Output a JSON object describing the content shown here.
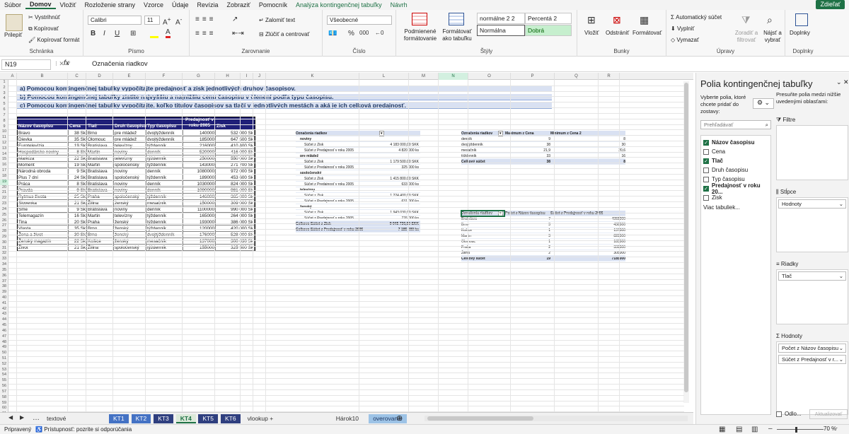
{
  "menu": {
    "items": [
      "Súbor",
      "Domov",
      "Vložiť",
      "Rozloženie strany",
      "Vzorce",
      "Údaje",
      "Revízia",
      "Zobraziť",
      "Pomocník",
      "Analýza kontingenčnej tabuľky",
      "Návrh"
    ],
    "share": "Zdieľať"
  },
  "ribbon": {
    "clipboard": {
      "paste": "Prilepiť",
      "cut": "Vystrihnúť",
      "copy": "Kopírovať",
      "format_painter": "Kopírovať formát",
      "label": "Schránka"
    },
    "font": {
      "name": "Calibri",
      "size": "11",
      "label": "Písmo",
      "bold": "B",
      "italic": "I",
      "underline": "U"
    },
    "alignment": {
      "wrap": "Zalomiť text",
      "merge": "Zlúčiť a centrovať",
      "label": "Zarovnanie"
    },
    "number": {
      "format": "Všeobecné",
      "percent": "%",
      "thousands": "000",
      "label": "Číslo"
    },
    "styles": {
      "conditional": "Podmienené formátovanie",
      "as_table": "Formátovať ako tabuľku",
      "s1": "normálne 2 2",
      "s2": "Percentá 2",
      "s3": "Normálna",
      "s4": "Dobrá",
      "label": "Štýly"
    },
    "cells": {
      "insert": "Vložiť",
      "delete": "Odstrániť",
      "format": "Formátovať",
      "label": "Bunky"
    },
    "editing": {
      "autosum": "Automatický súčet",
      "fill": "Vyplniť",
      "clear": "Vymazať",
      "sort": "Zoradiť a filtrovať",
      "find": "Nájsť a vybrať",
      "label": "Úpravy"
    },
    "addins": {
      "btn": "Doplnky",
      "label": "Doplnky"
    }
  },
  "formula_bar": {
    "name_box": "N19",
    "fx": "fx",
    "content": "Označenia riadkov"
  },
  "columns": [
    "A",
    "B",
    "C",
    "D",
    "E",
    "F",
    "G",
    "H",
    "I",
    "J",
    "K",
    "L",
    "M",
    "N",
    "O",
    "P",
    "Q",
    "R"
  ],
  "rows": [
    "1",
    "2",
    "3",
    "4",
    "5",
    "6",
    "7",
    "8",
    "9",
    "10",
    "11",
    "12",
    "13",
    "14",
    "15",
    "16",
    "17",
    "18",
    "19",
    "20",
    "21",
    "22",
    "23",
    "24",
    "25",
    "26",
    "27",
    "28",
    "29",
    "30",
    "31",
    "32",
    "33",
    "34",
    "35",
    "36",
    "37",
    "38",
    "39",
    "40",
    "41",
    "42",
    "43",
    "44",
    "45",
    "46",
    "47",
    "48",
    "49",
    "50",
    "51",
    "52",
    "53",
    "54",
    "55",
    "56",
    "57",
    "58",
    "59",
    "60",
    "61"
  ],
  "tasks": [
    "a) Pomocou kontingenčnej tabuľky vypočítajte predajnosť a zisk jednotlivých druhov časopisov.",
    "b) Pomocou kontingenčnej tabuľky zistite najvyššiu a najnižšiu cenu časopisu v členení podľa typu časopisu.",
    "c) Pomocou kontingenčnej tabuľky vypočítajte, koľko titulov časopisov sa tlačí v jednotlivých mestách a aká je ich celková predajnosť."
  ],
  "table": {
    "headers": [
      "Názov časopisu",
      "Cena",
      "Tlač",
      "Druh časopisu",
      "Typ časopisu",
      "Predajnosť v roku 2005",
      "Zisk"
    ],
    "rows": [
      [
        "Bravo",
        "38 Sk",
        "Brno",
        "pre mládež",
        "dvojtýždenník",
        "140000",
        "532 000 Sk"
      ],
      [
        "Dievka",
        "35 Sk",
        "Olomouc",
        "pre mládež",
        "dvojtýždenník",
        "185000",
        "647 500 Sk"
      ],
      [
        "Eurotelevízia",
        "19 Sk",
        "Bratislava",
        "televízny",
        "týždenník",
        "216000",
        "410 400 Sk"
      ],
      [
        "Hospodárske noviny",
        "8 Sk",
        "Martin",
        "noviny",
        "denník",
        "520000",
        "416 000 Sk"
      ],
      [
        "Markíza",
        "22 Sk",
        "Bratislava",
        "televízny",
        "týždenník",
        "250000",
        "550 000 Sk"
      ],
      [
        "Moment",
        "19 Sk",
        "Martin",
        "spoločenský",
        "týždenník",
        "143000",
        "271 700 Sk"
      ],
      [
        "Národná obroda",
        "9 Sk",
        "Bratislava",
        "noviny",
        "denník",
        "1080000",
        "972 000 Sk"
      ],
      [
        "Plus 7 dní",
        "24 Sk",
        "Bratislava",
        "spoločenský",
        "týždenník",
        "189000",
        "453 600 Sk"
      ],
      [
        "Práca",
        "8 Sk",
        "Bratislava",
        "noviny",
        "denník",
        "1030000",
        "824 000 Sk"
      ],
      [
        "Pravda",
        "9 Sk",
        "Bratislava",
        "noviny",
        "denník",
        "1090000",
        "981 000 Sk"
      ],
      [
        "Rytmus života",
        "25 Sk",
        "Praha",
        "spoločenský",
        "týždenník",
        "146000",
        "365 000 Sk"
      ],
      [
        "Slovenka",
        "21 Sk",
        "Žilina",
        "ženský",
        "mesačník",
        "150000",
        "309 000 Sk"
      ],
      [
        "Sme",
        "9 Sk",
        "Bratislava",
        "noviny",
        "denník",
        "1100000",
        "990 000 Sk"
      ],
      [
        "Telemagazín",
        "16 Sk",
        "Martin",
        "televízny",
        "týždenník",
        "165000",
        "264 000 Sk"
      ],
      [
        "Tina",
        "20 Sk",
        "Praha",
        "ženský",
        "týždenník",
        "193000",
        "386 000 Sk"
      ],
      [
        "Vlasta",
        "35 Sk",
        "Brno",
        "ženský",
        "týždenník",
        "120000",
        "420 000 Sk"
      ],
      [
        "Žena a život",
        "30 Sk",
        "Brno",
        "ženský",
        "dvojtýždenník",
        "176000",
        "528 000 Sk"
      ],
      [
        "Ženský magazín",
        "22 Sk",
        "Košice",
        "ženský",
        "mesačník",
        "137000",
        "300 030 Sk"
      ],
      [
        "Život",
        "21 Sk",
        "Žilina",
        "spoločenský",
        "týždenník",
        "155000",
        "325 500 Sk"
      ]
    ]
  },
  "pivot1": {
    "header": "Označenia riadkov",
    "rows": [
      {
        "label": "noviny",
        "v": "",
        "lvl": 0
      },
      {
        "label": "Súčet z Zisk",
        "v": "4 183 000,00 SKK",
        "lvl": 1
      },
      {
        "label": "Súčet z Predajnosť v roku 2005",
        "v": "4 820 000 ks",
        "lvl": 1
      },
      {
        "label": "pre mládež",
        "v": "",
        "lvl": 0
      },
      {
        "label": "Súčet z Zisk",
        "v": "1 179 500,00 SKK",
        "lvl": 1
      },
      {
        "label": "Súčet z Predajnosť v roku 2005",
        "v": "325 000 ks",
        "lvl": 1
      },
      {
        "label": "spoločenský",
        "v": "",
        "lvl": 0
      },
      {
        "label": "Súčet z Zisk",
        "v": "1 415 800,00 SKK",
        "lvl": 1
      },
      {
        "label": "Súčet z Predajnosť v roku 2005",
        "v": "633 000 ks",
        "lvl": 1
      },
      {
        "label": "televízny",
        "v": "",
        "lvl": 0
      },
      {
        "label": "Súčet z Zisk",
        "v": "1 224 400,00 SKK",
        "lvl": 1
      },
      {
        "label": "Súčet z Predajnosť v roku 2005",
        "v": "631 000 ks",
        "lvl": 1
      },
      {
        "label": "ženský",
        "v": "",
        "lvl": 0
      },
      {
        "label": "Súčet z Zisk",
        "v": "1 943 030,00 SKK",
        "lvl": 1
      },
      {
        "label": "Súčet z Predajnosť v roku 2005",
        "v": "776 000 ks",
        "lvl": 1
      },
      {
        "label": "Celkovo Súčet z Zisk",
        "v": "9 945 730,00 SKK",
        "lvl": 2
      },
      {
        "label": "Celkovo Súčet z Predajnosť v roku 2005",
        "v": "7 185 000 ks",
        "lvl": 2
      }
    ]
  },
  "pivot2": {
    "headers": [
      "Označenia riadkov",
      "Maximum z Cena",
      "Minimum z Cena 2"
    ],
    "rows": [
      [
        "denník",
        "9",
        "8"
      ],
      [
        "dvojtýždenník",
        "38",
        "30"
      ],
      [
        "mesačník",
        "21,9",
        "20,6"
      ],
      [
        "týždenník",
        "33",
        "16"
      ]
    ],
    "total": [
      "Celkový súčet",
      "38",
      "8"
    ]
  },
  "pivot3": {
    "headers": [
      "Označenia riadkov",
      "Počet z Názov časopisu",
      "Súčet z Predajnosť v roku 2005"
    ],
    "rows": [
      [
        "Bratislava",
        "7",
        "4955000"
      ],
      [
        "Brno",
        "3",
        "436000"
      ],
      [
        "Košice",
        "1",
        "137000"
      ],
      [
        "Martin",
        "3",
        "828000"
      ],
      [
        "Olomouc",
        "1",
        "185000"
      ],
      [
        "Praha",
        "2",
        "339000"
      ],
      [
        "Žilina",
        "2",
        "305000"
      ]
    ],
    "total": [
      "Celkový súčet",
      "19",
      "7185000"
    ]
  },
  "sheets": [
    {
      "name": "textové funkcie",
      "style": "plain"
    },
    {
      "name": "KT1",
      "style": "blue"
    },
    {
      "name": "KT2",
      "style": "blue"
    },
    {
      "name": "KT3",
      "style": "navy"
    },
    {
      "name": "KT4",
      "style": "active"
    },
    {
      "name": "KT5",
      "style": "navy"
    },
    {
      "name": "KT6",
      "style": "navy"
    },
    {
      "name": "vlookup + štatistické",
      "style": "plain"
    },
    {
      "name": "Hárok10",
      "style": "plain"
    },
    {
      "name": "overovanie údajov",
      "style": "lightblue"
    }
  ],
  "status": {
    "ready": "Pripravený",
    "access": "Prístupnosť: pozrite si odporúčania",
    "zoom": "70 %"
  },
  "pane": {
    "title": "Polia kontingenčnej tabuľky",
    "choose": "Vyberte polia, ktoré chcete pridať do zostavy:",
    "move": "Presuňte polia medzi nižšie uvedenými oblasťami:",
    "search": "Prehľadávať",
    "fields": [
      {
        "name": "Názov časopisu",
        "on": true
      },
      {
        "name": "Cena",
        "on": false
      },
      {
        "name": "Tlač",
        "on": true
      },
      {
        "name": "Druh časopisu",
        "on": false
      },
      {
        "name": "Typ časopisu",
        "on": false
      },
      {
        "name": "Predajnosť v roku 20...",
        "on": true
      },
      {
        "name": "Zisk",
        "on": false
      }
    ],
    "more": "Viac tabuliek...",
    "filters": "Filtre",
    "columns": "Stĺpce",
    "columns_val": "Hodnoty",
    "rows": "Riadky",
    "rows_val": "Tlač",
    "values": "Hodnoty",
    "values_items": [
      "Počet z Názov časopisu",
      "Súčet z Predajnosť v r..."
    ],
    "defer": "Odlo...",
    "update": "Aktualizovať"
  }
}
